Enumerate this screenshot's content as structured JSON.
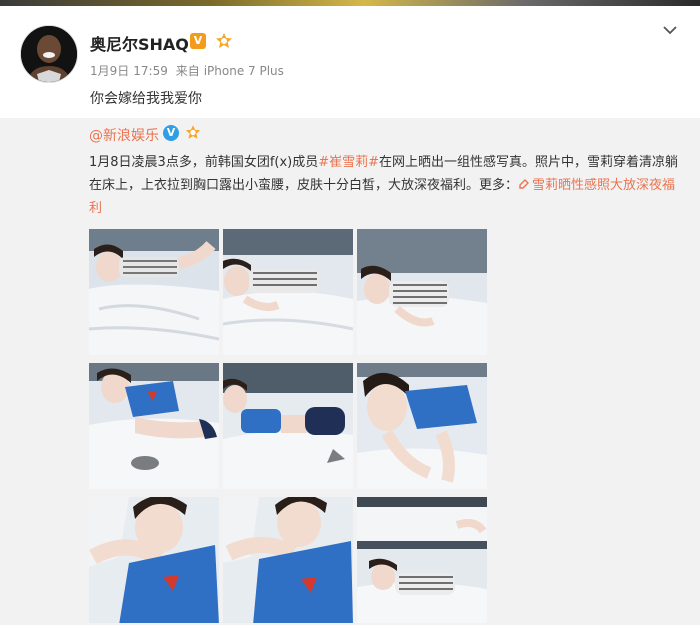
{
  "post": {
    "username": "奥尼尔SHAQ",
    "verified_badge": "V",
    "date": "1月9日",
    "time": "17:59",
    "source_prefix": "来自",
    "source_device": "iPhone 7 Plus",
    "text": "你会嫁给我我爱你"
  },
  "repost": {
    "username": "@新浪娱乐",
    "verified_badge": "V",
    "text_part1": "1月8日凌晨3点多，前韩国女团f(x)成员",
    "hashtag": "#崔雪莉#",
    "text_part2": "在网上晒出一组性感写真。照片中，雪莉穿着清凉躺在床上，上衣拉到胸口露出小蛮腰，皮肤十分白皙，大放深夜福利。更多：",
    "link_text": "雪莉晒性感照大放深夜福利"
  },
  "photos": [
    {
      "id": 1,
      "top": "white-striped"
    },
    {
      "id": 2,
      "top": "white-striped"
    },
    {
      "id": 3,
      "top": "white-striped"
    },
    {
      "id": 4,
      "top": "blue-superman"
    },
    {
      "id": 5,
      "top": "blue-superman"
    },
    {
      "id": 6,
      "top": "blue-superman"
    },
    {
      "id": 7,
      "top": "blue-superman"
    },
    {
      "id": 8,
      "top": "blue-superman"
    },
    {
      "id": 9,
      "top": "white-striped"
    }
  ],
  "colors": {
    "link": "#eb7350",
    "verified_blue": "#2e9ee6",
    "verified_orange": "#f49b1c",
    "panel_bg": "#f2f2f2"
  }
}
